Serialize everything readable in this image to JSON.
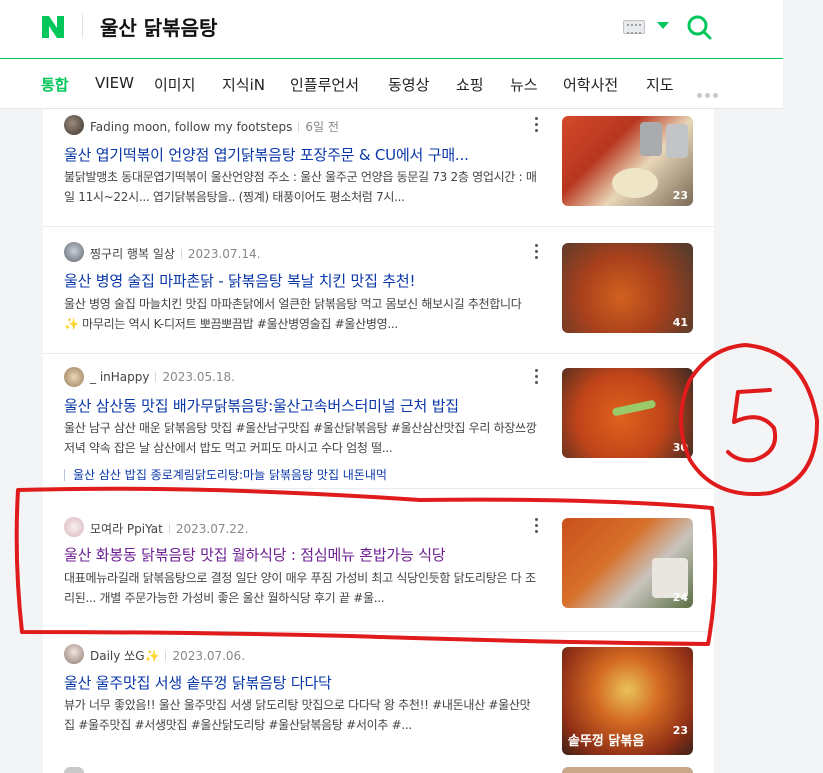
{
  "header": {
    "query": "울산 닭볶음탕",
    "logo_letter": "N",
    "brand_color": "#03c75a"
  },
  "tabs": [
    {
      "label": "통합",
      "active": true
    },
    {
      "label": "VIEW"
    },
    {
      "label": "이미지"
    },
    {
      "label": "지식iN"
    },
    {
      "label": "인플루언서"
    },
    {
      "label": "동영상"
    },
    {
      "label": "쇼핑"
    },
    {
      "label": "뉴스"
    },
    {
      "label": "어학사전"
    },
    {
      "label": "지도"
    }
  ],
  "results": [
    {
      "author": "Fading moon, follow my footsteps",
      "date": "6일 전",
      "title": "울산 엽기떡볶이 언양점 엽기닭볶음탕 포장주문 & CU에서 구매...",
      "desc": "불닭발맹초 동대문엽기떡볶이 울산언양점 주소 : 울산 울주군 언양읍 동문길 73 2층 영업시간 : 매일 11시~22시... 엽기닭볶음탕을.. (찡계) 태풍이어도 평소처럼 7시...",
      "thumb_count": "23"
    },
    {
      "author": "찡구리 행복 일상",
      "date": "2023.07.14.",
      "title": "울산 병영 술집 마파촌닭 - 닭볶음탕 복날 치킨 맛집 추천!",
      "desc": "울산 병영 술집 마늘치킨 맛집 마파촌닭에서 얼큰한 닭볶음탕 먹고 몸보신 해보시길 추천합니다 ✨ 마무리는 역시 K-디저트 뽀끔뽀끔밥 #울산병영술집 #울산병영...",
      "thumb_count": "41"
    },
    {
      "author": "_ inHappy",
      "date": "2023.05.18.",
      "title": "울산 삼산동 맛집 배가무닭볶음탕:울산고속버스터미널 근처 밥집",
      "desc": "울산 남구 삼산 매운 닭볶음탕 맛집 #울산남구맛집 #울산닭볶음탕 #울산삼산맛집 우리 하장쓰깡 저녁 약속 잡은 날 삼산에서 밥도 먹고 커피도 마시고 수다 엄청 떨...",
      "thumb_count": "30",
      "sub_link": "울산 삼산 밥집 종로계림닭도리탕:마늘 닭볶음탕 맛집 내돈내먹"
    },
    {
      "author": "모여라 PpiYat",
      "date": "2023.07.22.",
      "title": "울산 화봉동 닭볶음탕 맛집 월하식당 : 점심메뉴 혼밥가능 식당",
      "desc": "대표메뉴라길래 닭볶음탕으로 결정 일단 양이 매우 푸짐 가성비 최고 식당인듯함 닭도리탕은 다 조리된... 개별 주문가능한 가성비 좋은 울산 월하식당 후기 끝 #울...",
      "thumb_count": "24"
    },
    {
      "author": "Daily 쏘G✨",
      "date": "2023.07.06.",
      "title": "울산 울주맛집 서생 솥뚜껑 닭볶음탕 다다닥",
      "desc": "뷰가 너무 좋았음!! 울산 울주맛집 서생 닭도리탕 맛집으로 다다닥 왕 추천!! #내돈내산 #울산맛집 #울주맛집 #서생맛집 #울산닭도리탕 #울산닭볶음탕 #서이추 #...",
      "thumb_count": "23",
      "thumb_caption": "솥뚜껑 닭볶음"
    }
  ],
  "annotation": {
    "number": "5",
    "color": "#e01b1b"
  }
}
